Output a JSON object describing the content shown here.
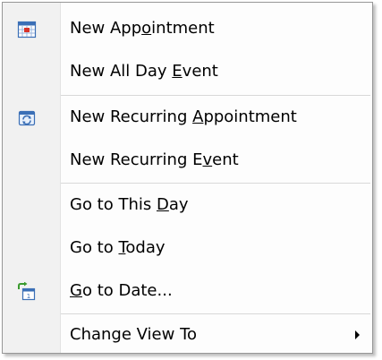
{
  "menu": {
    "items": [
      {
        "pre": "New App",
        "key": "o",
        "post": "intment",
        "icon": "calendar-appointment-icon"
      },
      {
        "pre": "New All Day ",
        "key": "E",
        "post": "vent",
        "icon": ""
      },
      {
        "pre": "New Recurring ",
        "key": "A",
        "post": "ppointment",
        "icon": "recurring-appointment-icon"
      },
      {
        "pre": "New Recurring E",
        "key": "v",
        "post": "ent",
        "icon": ""
      },
      {
        "pre": "Go to This ",
        "key": "D",
        "post": "ay",
        "icon": ""
      },
      {
        "pre": "Go to ",
        "key": "T",
        "post": "oday",
        "icon": ""
      },
      {
        "pre": "",
        "key": "G",
        "post": "o to Date...",
        "icon": "go-to-date-icon"
      },
      {
        "pre": "Change View To",
        "key": "",
        "post": "",
        "icon": "submenu-arrow-icon"
      }
    ]
  },
  "colors": {
    "icon_blue": "#3b6fb6",
    "icon_red": "#d9342b",
    "icon_green": "#3a9a2e"
  }
}
